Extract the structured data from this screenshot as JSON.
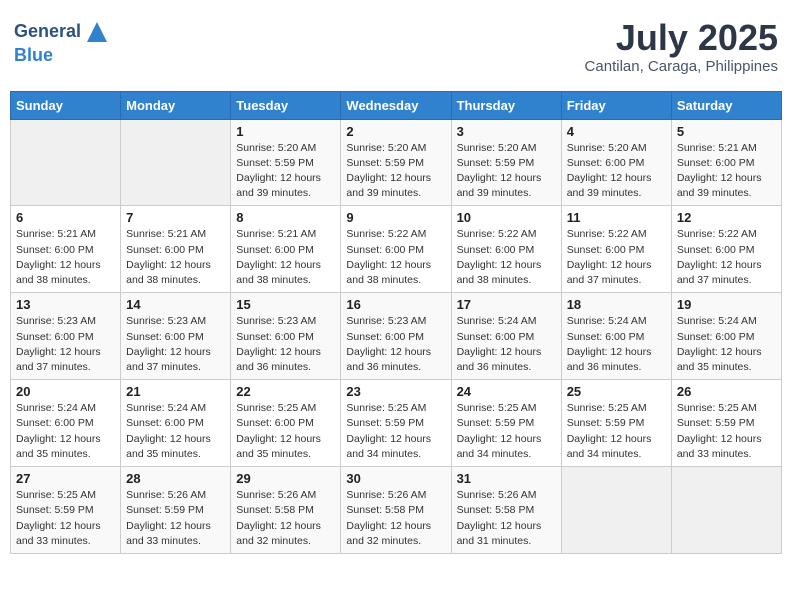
{
  "header": {
    "logo_line1": "General",
    "logo_line2": "Blue",
    "month_year": "July 2025",
    "location": "Cantilan, Caraga, Philippines"
  },
  "weekdays": [
    "Sunday",
    "Monday",
    "Tuesday",
    "Wednesday",
    "Thursday",
    "Friday",
    "Saturday"
  ],
  "weeks": [
    [
      {
        "day": "",
        "empty": true
      },
      {
        "day": "",
        "empty": true
      },
      {
        "day": "1",
        "sunrise": "5:20 AM",
        "sunset": "5:59 PM",
        "daylight": "12 hours and 39 minutes."
      },
      {
        "day": "2",
        "sunrise": "5:20 AM",
        "sunset": "5:59 PM",
        "daylight": "12 hours and 39 minutes."
      },
      {
        "day": "3",
        "sunrise": "5:20 AM",
        "sunset": "5:59 PM",
        "daylight": "12 hours and 39 minutes."
      },
      {
        "day": "4",
        "sunrise": "5:20 AM",
        "sunset": "6:00 PM",
        "daylight": "12 hours and 39 minutes."
      },
      {
        "day": "5",
        "sunrise": "5:21 AM",
        "sunset": "6:00 PM",
        "daylight": "12 hours and 39 minutes."
      }
    ],
    [
      {
        "day": "6",
        "sunrise": "5:21 AM",
        "sunset": "6:00 PM",
        "daylight": "12 hours and 38 minutes."
      },
      {
        "day": "7",
        "sunrise": "5:21 AM",
        "sunset": "6:00 PM",
        "daylight": "12 hours and 38 minutes."
      },
      {
        "day": "8",
        "sunrise": "5:21 AM",
        "sunset": "6:00 PM",
        "daylight": "12 hours and 38 minutes."
      },
      {
        "day": "9",
        "sunrise": "5:22 AM",
        "sunset": "6:00 PM",
        "daylight": "12 hours and 38 minutes."
      },
      {
        "day": "10",
        "sunrise": "5:22 AM",
        "sunset": "6:00 PM",
        "daylight": "12 hours and 38 minutes."
      },
      {
        "day": "11",
        "sunrise": "5:22 AM",
        "sunset": "6:00 PM",
        "daylight": "12 hours and 37 minutes."
      },
      {
        "day": "12",
        "sunrise": "5:22 AM",
        "sunset": "6:00 PM",
        "daylight": "12 hours and 37 minutes."
      }
    ],
    [
      {
        "day": "13",
        "sunrise": "5:23 AM",
        "sunset": "6:00 PM",
        "daylight": "12 hours and 37 minutes."
      },
      {
        "day": "14",
        "sunrise": "5:23 AM",
        "sunset": "6:00 PM",
        "daylight": "12 hours and 37 minutes."
      },
      {
        "day": "15",
        "sunrise": "5:23 AM",
        "sunset": "6:00 PM",
        "daylight": "12 hours and 36 minutes."
      },
      {
        "day": "16",
        "sunrise": "5:23 AM",
        "sunset": "6:00 PM",
        "daylight": "12 hours and 36 minutes."
      },
      {
        "day": "17",
        "sunrise": "5:24 AM",
        "sunset": "6:00 PM",
        "daylight": "12 hours and 36 minutes."
      },
      {
        "day": "18",
        "sunrise": "5:24 AM",
        "sunset": "6:00 PM",
        "daylight": "12 hours and 36 minutes."
      },
      {
        "day": "19",
        "sunrise": "5:24 AM",
        "sunset": "6:00 PM",
        "daylight": "12 hours and 35 minutes."
      }
    ],
    [
      {
        "day": "20",
        "sunrise": "5:24 AM",
        "sunset": "6:00 PM",
        "daylight": "12 hours and 35 minutes."
      },
      {
        "day": "21",
        "sunrise": "5:24 AM",
        "sunset": "6:00 PM",
        "daylight": "12 hours and 35 minutes."
      },
      {
        "day": "22",
        "sunrise": "5:25 AM",
        "sunset": "6:00 PM",
        "daylight": "12 hours and 35 minutes."
      },
      {
        "day": "23",
        "sunrise": "5:25 AM",
        "sunset": "5:59 PM",
        "daylight": "12 hours and 34 minutes."
      },
      {
        "day": "24",
        "sunrise": "5:25 AM",
        "sunset": "5:59 PM",
        "daylight": "12 hours and 34 minutes."
      },
      {
        "day": "25",
        "sunrise": "5:25 AM",
        "sunset": "5:59 PM",
        "daylight": "12 hours and 34 minutes."
      },
      {
        "day": "26",
        "sunrise": "5:25 AM",
        "sunset": "5:59 PM",
        "daylight": "12 hours and 33 minutes."
      }
    ],
    [
      {
        "day": "27",
        "sunrise": "5:25 AM",
        "sunset": "5:59 PM",
        "daylight": "12 hours and 33 minutes."
      },
      {
        "day": "28",
        "sunrise": "5:26 AM",
        "sunset": "5:59 PM",
        "daylight": "12 hours and 33 minutes."
      },
      {
        "day": "29",
        "sunrise": "5:26 AM",
        "sunset": "5:58 PM",
        "daylight": "12 hours and 32 minutes."
      },
      {
        "day": "30",
        "sunrise": "5:26 AM",
        "sunset": "5:58 PM",
        "daylight": "12 hours and 32 minutes."
      },
      {
        "day": "31",
        "sunrise": "5:26 AM",
        "sunset": "5:58 PM",
        "daylight": "12 hours and 31 minutes."
      },
      {
        "day": "",
        "empty": true
      },
      {
        "day": "",
        "empty": true
      }
    ]
  ]
}
